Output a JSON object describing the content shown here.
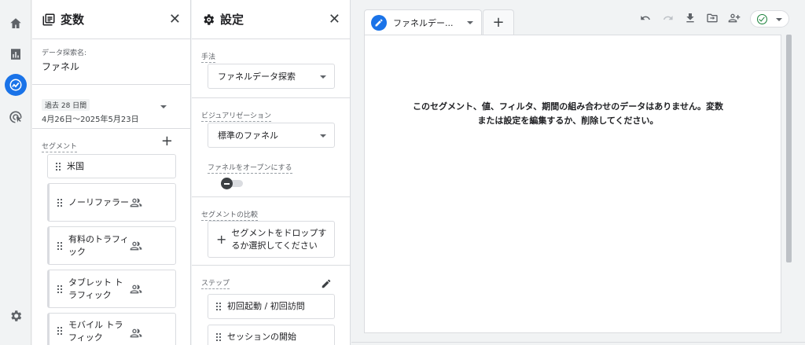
{
  "nav": {
    "items": [
      {
        "name": "home-icon"
      },
      {
        "name": "reports-icon"
      },
      {
        "name": "explore-icon",
        "active": true
      },
      {
        "name": "advertising-icon"
      }
    ],
    "settings": {
      "name": "settings-gear-icon"
    }
  },
  "variables": {
    "title": "変数",
    "exploration_label": "データ探索名:",
    "exploration_name": "ファネル",
    "date_chip": "過去 28 日間",
    "date_range": "4月26日～2025年5月23日",
    "segments_label": "セグメント",
    "segments": [
      {
        "label": "米国",
        "has_user_icon": false
      },
      {
        "label": "ノーリファラー",
        "has_user_icon": true
      },
      {
        "label": "有料のトラフィック",
        "has_user_icon": true
      },
      {
        "label": "タブレット トラフィック",
        "has_user_icon": true
      },
      {
        "label": "モバイル トラフィック",
        "has_user_icon": true
      }
    ]
  },
  "settings": {
    "title": "設定",
    "technique_label": "手法",
    "technique_value": "ファネルデータ探索",
    "visualization_label": "ビジュアリゼーション",
    "visualization_value": "標準のファネル",
    "open_funnel_label": "ファネルをオープンにする",
    "open_funnel_on": false,
    "segment_compare_label": "セグメントの比較",
    "segment_drop_text": "セグメントをドロップするか選択してください",
    "steps_label": "ステップ",
    "steps": [
      "初回起動 / 初回訪問",
      "セッションの開始"
    ]
  },
  "canvas": {
    "tab_label": "ファネルデー...",
    "add_tab": "+",
    "toolbar": [
      "undo-icon",
      "redo-icon",
      "download-icon",
      "move-to-folder-icon",
      "share-user-icon"
    ],
    "empty_message": "このセグメント、値、フィルタ、期間の組み合わせのデータはありません。変数または設定を編集するか、削除してください。"
  },
  "colors": {
    "accent": "#1a73e8",
    "success": "#188038",
    "border": "#dadce0",
    "background": "#f1f3f4"
  }
}
